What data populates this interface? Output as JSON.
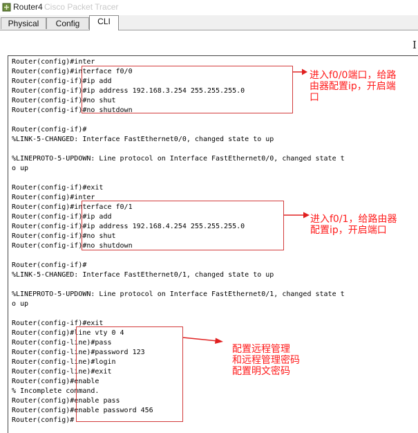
{
  "window": {
    "title": "Router4",
    "ghost_title": "Cisco Packet Tracer"
  },
  "tabs": [
    {
      "label": "Physical",
      "active": false
    },
    {
      "label": "Config",
      "active": false
    },
    {
      "label": "CLI",
      "active": true
    }
  ],
  "cli_lines": [
    "Router(config)#inter",
    "Router(config)#interface f0/0",
    "Router(config-if)#ip add",
    "Router(config-if)#ip address 192.168.3.254 255.255.255.0",
    "Router(config-if)#no shut",
    "Router(config-if)#no shutdown",
    "",
    "Router(config-if)#",
    "%LINK-5-CHANGED: Interface FastEthernet0/0, changed state to up",
    "",
    "%LINEPROTO-5-UPDOWN: Line protocol on Interface FastEthernet0/0, changed state t",
    "o up",
    "",
    "Router(config-if)#exit",
    "Router(config)#inter",
    "Router(config)#interface f0/1",
    "Router(config-if)#ip add",
    "Router(config-if)#ip address 192.168.4.254 255.255.255.0",
    "Router(config-if)#no shut",
    "Router(config-if)#no shutdown",
    "",
    "Router(config-if)#",
    "%LINK-5-CHANGED: Interface FastEthernet0/1, changed state to up",
    "",
    "%LINEPROTO-5-UPDOWN: Line protocol on Interface FastEthernet0/1, changed state t",
    "o up",
    "",
    "Router(config-if)#exit",
    "Router(config)#line vty 0 4",
    "Router(config-line)#pass",
    "Router(config-line)#password 123",
    "Router(config-line)#login",
    "Router(config-line)#exit",
    "Router(config)#enable",
    "% Incomplete command.",
    "Router(config)#enable pass",
    "Router(config)#enable password 456",
    "Router(config)#"
  ],
  "annotations": {
    "f0_0": [
      "进入f0/0端口，给路",
      "由器配置ip，开启端",
      "口"
    ],
    "f0_1": [
      "进入f0/1，给路由器",
      "配置ip，开启端口"
    ],
    "vty": [
      "配置远程管理",
      "和远程管理密码",
      "配置明文密码"
    ]
  },
  "colors": {
    "annotation": "#ff1a1a",
    "box": "#d23a3a"
  },
  "icons": {
    "app": "router-app-icon",
    "cursor": "text-cursor-icon"
  }
}
